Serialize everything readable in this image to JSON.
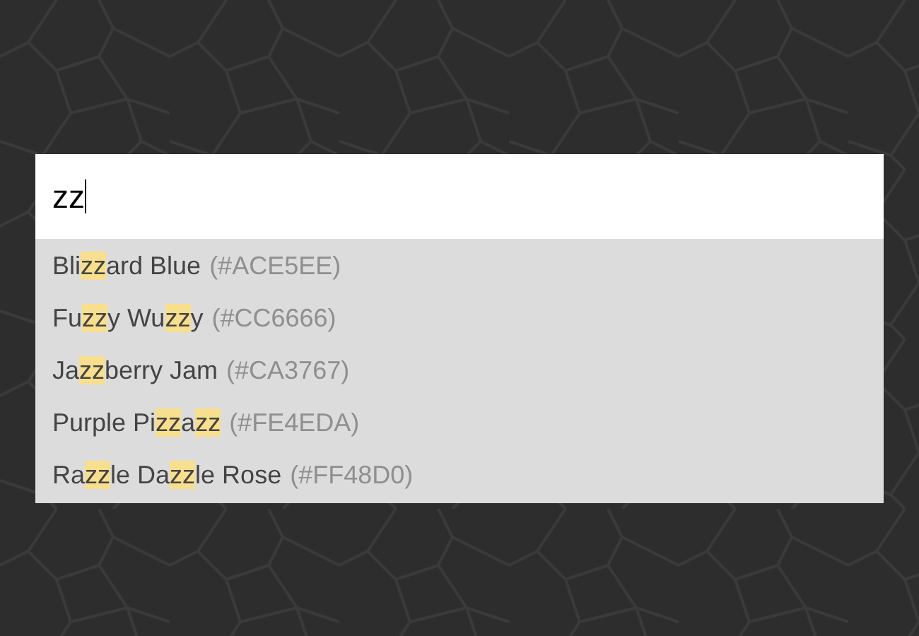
{
  "search": {
    "value": "zz"
  },
  "suggestions": [
    {
      "name": "Bli**zz**ard Blue",
      "code": "(#ACE5EE)"
    },
    {
      "name": "Fu**zz**y Wu**zz**y",
      "code": "(#CC6666)"
    },
    {
      "name": "Ja**zz**berry Jam",
      "code": "(#CA3767)"
    },
    {
      "name": "Purple Pi**zz**a**zz**",
      "code": "(#FE4EDA)"
    },
    {
      "name": "Ra**zz**le Da**zz**le Rose",
      "code": "(#FF48D0)"
    }
  ]
}
